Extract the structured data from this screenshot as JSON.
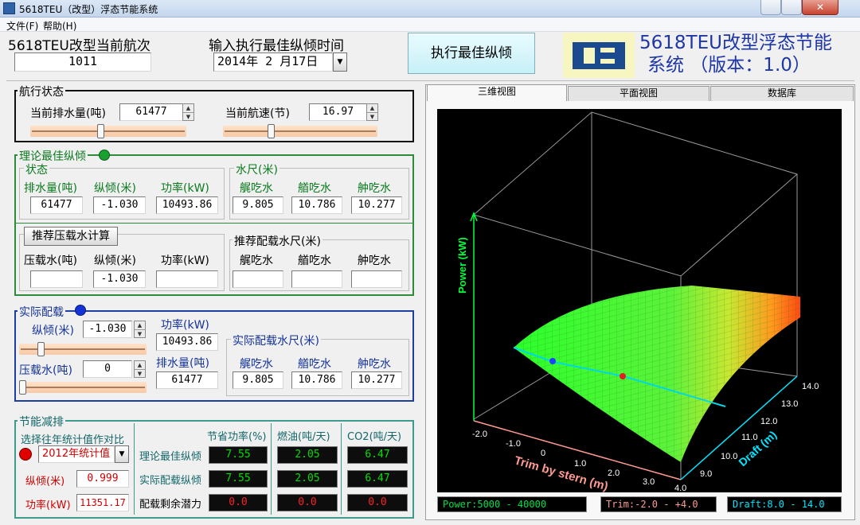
{
  "window": {
    "title": "5618TEU（改型）浮态节能系统",
    "close": "✕"
  },
  "menu": {
    "file": "文件(F)",
    "help": "帮助(H)"
  },
  "header": {
    "voyage_label": "5618TEU改型当前航次",
    "voyage_value": "1011",
    "exec_time_label": "输入执行最佳纵倾时间",
    "exec_date": "2014年 2 月17日",
    "execute_button": "执行最佳纵倾",
    "logo_text": "CS",
    "app_title_line1": "5618TEU改型浮态节能",
    "app_title_line2": "系统 （版本：1.0）"
  },
  "voyage_state": {
    "title": "航行状态",
    "displacement_label": "当前排水量(吨)",
    "displacement_value": "61477",
    "displacement_slider": 0.45,
    "speed_label": "当前航速(节)",
    "speed_value": "16.97",
    "speed_slider": 0.3
  },
  "theory": {
    "title": "理论最佳纵倾",
    "status_title": "状态",
    "displacement_label": "排水量(吨)",
    "trim_label": "纵倾(米)",
    "power_label": "功率(kW)",
    "displacement": "61477",
    "trim": "-1.030",
    "power": "10493.86",
    "draft_title": "水尺(米)",
    "aft_label": "艉吃水",
    "fwd_label": "艏吃水",
    "mid_label": "舯吃水",
    "aft": "9.805",
    "fwd": "10.786",
    "mid": "10.277"
  },
  "ballast": {
    "calc_button": "推荐压载水计算",
    "ballast_label": "压载水(吨)",
    "trim_label": "纵倾(米)",
    "power_label": "功率(kW)",
    "ballast": "",
    "trim": "-1.030",
    "power": "",
    "draft_title": "推荐配载水尺(米)",
    "aft_label": "艉吃水",
    "fwd_label": "艏吃水",
    "mid_label": "舯吃水",
    "aft": "",
    "fwd": "",
    "mid": ""
  },
  "actual": {
    "title": "实际配载",
    "trim_label": "纵倾(米)",
    "trim": "-1.030",
    "trim_slider": 0.15,
    "power_label": "功率(kW)",
    "power": "10493.86",
    "ballast_label": "压载水(吨)",
    "ballast": "0",
    "ballast_slider": 0.0,
    "displacement_label": "排水量(吨)",
    "displacement": "61477",
    "draft_title": "实际配载水尺(米)",
    "aft_label": "艉吃水",
    "fwd_label": "艏吃水",
    "mid_label": "舯吃水",
    "aft": "9.805",
    "fwd": "10.786",
    "mid": "10.277"
  },
  "saving": {
    "title": "节能减排",
    "compare_label": "选择往年统计值作对比",
    "year_select": "2012年统计值",
    "col_power": "节省功率(%)",
    "col_fuel": "燃油(吨/天)",
    "col_co2": "CO2(吨/天)",
    "trim_label": "纵倾(米)",
    "trim": "0.999",
    "power_label": "功率(kW)",
    "power": "11351.17",
    "rows": [
      {
        "label": "理论最佳纵倾",
        "power": "7.55",
        "fuel": "2.05",
        "co2": "6.47"
      },
      {
        "label": "实际配载纵倾",
        "power": "7.55",
        "fuel": "2.05",
        "co2": "6.47"
      },
      {
        "label": "配载剩余潜力",
        "power": "0.0",
        "fuel": "0.0",
        "co2": "0.0"
      }
    ],
    "colors": {
      "good": "#00e000",
      "bad": "#ff2020",
      "dot": "#e00000"
    }
  },
  "tabs": [
    "三维视图",
    "平面视图",
    "数据库"
  ],
  "plot": {
    "axis_power": "Power (kW)",
    "axis_trim": "Trim by stern (m)",
    "axis_draft": "Draft (m)",
    "trim_ticks": [
      "-2.0",
      "-1.0",
      "0",
      "1.0",
      "2.0",
      "3.0",
      "4.0"
    ],
    "draft_ticks": [
      "9.0",
      "10.0",
      "11.0",
      "12.0",
      "13.0",
      "14.0"
    ]
  },
  "status": {
    "power": "Power:5000 - 40000",
    "trim": "Trim:-2.0 - +4.0",
    "draft": "Draft:8.0 - 14.0"
  }
}
